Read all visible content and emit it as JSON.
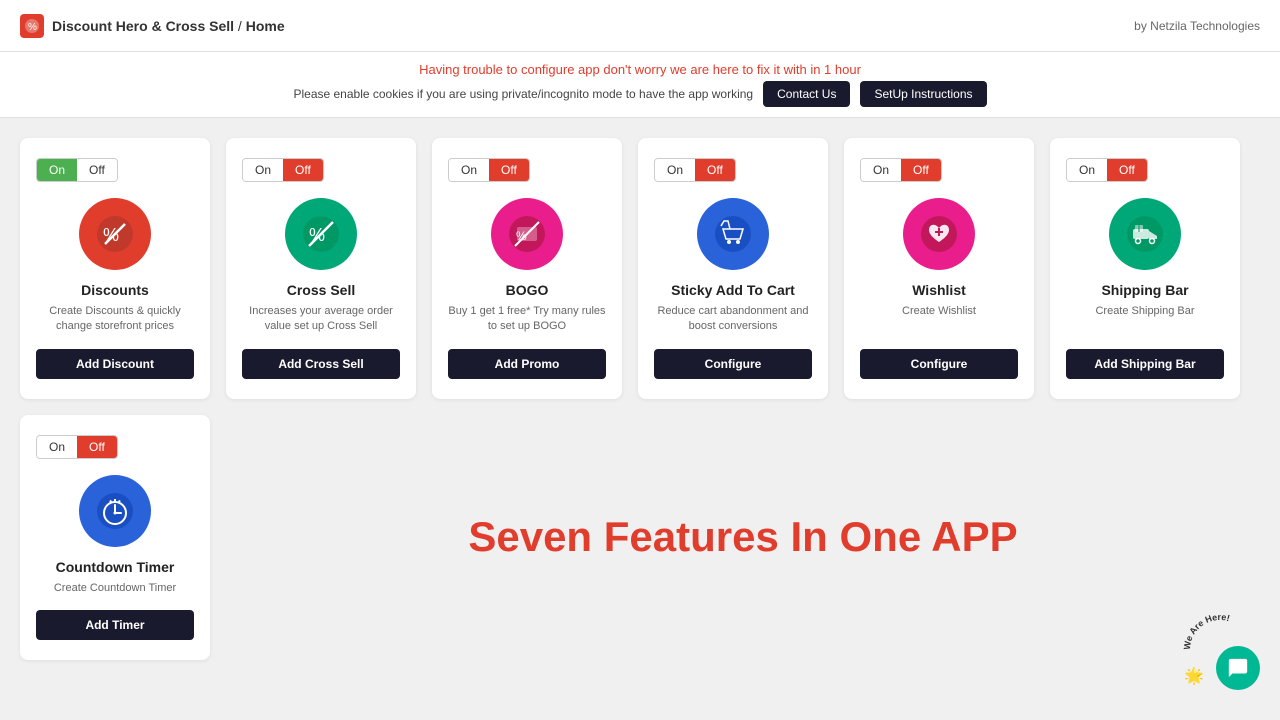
{
  "header": {
    "app_name": "Discount Hero & Cross Sell",
    "separator": "/",
    "page": "Home",
    "by": "by Netzila Technologies"
  },
  "notice": {
    "line1": "Having trouble to configure app don't worry we are here to fix it with in 1 hour",
    "line2": "Please enable cookies if you are using private/incognito mode to have the app working",
    "contact_label": "Contact Us",
    "setup_label": "SetUp Instructions"
  },
  "cards": [
    {
      "id": "discounts",
      "title": "Discounts",
      "desc": "Create Discounts & quickly change storefront prices",
      "button_label": "Add Discount",
      "toggle_on": true,
      "icon_color": "#e03d2d"
    },
    {
      "id": "cross-sell",
      "title": "Cross Sell",
      "desc": "Increases your average order value set up Cross Sell",
      "button_label": "Add Cross Sell",
      "toggle_on": false,
      "icon_color": "#00a878"
    },
    {
      "id": "bogo",
      "title": "BOGO",
      "desc": "Buy 1 get 1 free* Try many rules to set up BOGO",
      "button_label": "Add Promo",
      "toggle_on": false,
      "icon_color": "#e91e8c"
    },
    {
      "id": "sticky-add-to-cart",
      "title": "Sticky Add To Cart",
      "desc": "Reduce cart abandonment and boost conversions",
      "button_label": "Configure",
      "toggle_on": false,
      "icon_color": "#2962d9"
    },
    {
      "id": "wishlist",
      "title": "Wishlist",
      "desc": "Create Wishlist",
      "button_label": "Configure",
      "toggle_on": false,
      "icon_color": "#e91e8c"
    },
    {
      "id": "shipping-bar",
      "title": "Shipping Bar",
      "desc": "Create Shipping Bar",
      "button_label": "Add Shipping Bar",
      "toggle_on": false,
      "icon_color": "#00a878"
    }
  ],
  "second_row_cards": [
    {
      "id": "countdown-timer",
      "title": "Countdown Timer",
      "desc": "Create Countdown Timer",
      "button_label": "Add Timer",
      "toggle_on": false,
      "icon_color": "#2962d9"
    }
  ],
  "big_text": "Seven Features In One APP",
  "toggle_labels": {
    "on": "On",
    "off": "Off"
  }
}
